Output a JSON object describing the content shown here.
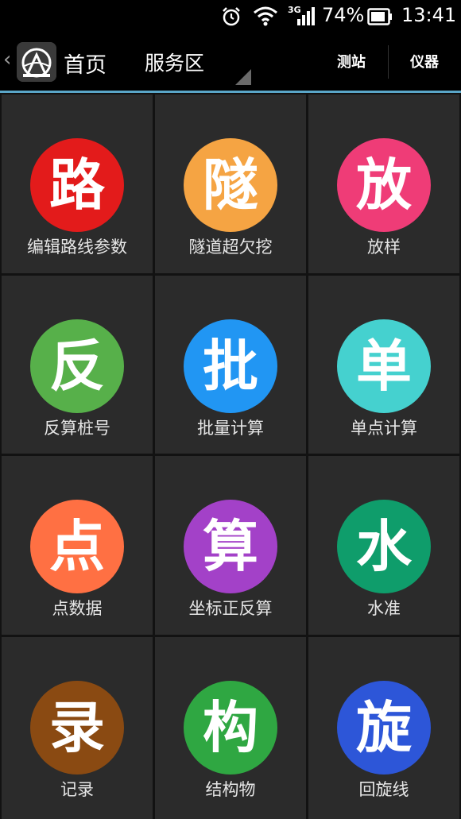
{
  "status_bar": {
    "battery_percent": "74%",
    "time": "13:41",
    "network_label": "3G",
    "alarm_icon": "alarm-clock-icon",
    "wifi_icon": "wifi-icon",
    "signal_icon": "cell-signal-icon",
    "battery_icon": "battery-icon"
  },
  "action_bar": {
    "home_title": "首页",
    "service_title": "服务区",
    "btn_station": "测站",
    "btn_instrument": "仪器",
    "back_icon": "chevron-left-icon",
    "app_icon": "survey-app-icon"
  },
  "tiles": [
    {
      "glyph": "路",
      "label": "编辑路线参数",
      "color": "#e31b1b"
    },
    {
      "glyph": "隧",
      "label": "隧道超欠挖",
      "color": "#f5a443"
    },
    {
      "glyph": "放",
      "label": "放样",
      "color": "#ef3c77"
    },
    {
      "glyph": "反",
      "label": "反算桩号",
      "color": "#57b04a"
    },
    {
      "glyph": "批",
      "label": "批量计算",
      "color": "#2196f3"
    },
    {
      "glyph": "单",
      "label": "单点计算",
      "color": "#45d1cf"
    },
    {
      "glyph": "点",
      "label": "点数据",
      "color": "#ff7043"
    },
    {
      "glyph": "算",
      "label": "坐标正反算",
      "color": "#a341c8"
    },
    {
      "glyph": "水",
      "label": "水准",
      "color": "#0f9d6b"
    },
    {
      "glyph": "录",
      "label": "记录",
      "color": "#8a4a12"
    },
    {
      "glyph": "构",
      "label": "结构物",
      "color": "#2fa742"
    },
    {
      "glyph": "旋",
      "label": "回旋线",
      "color": "#2d56d8"
    }
  ]
}
